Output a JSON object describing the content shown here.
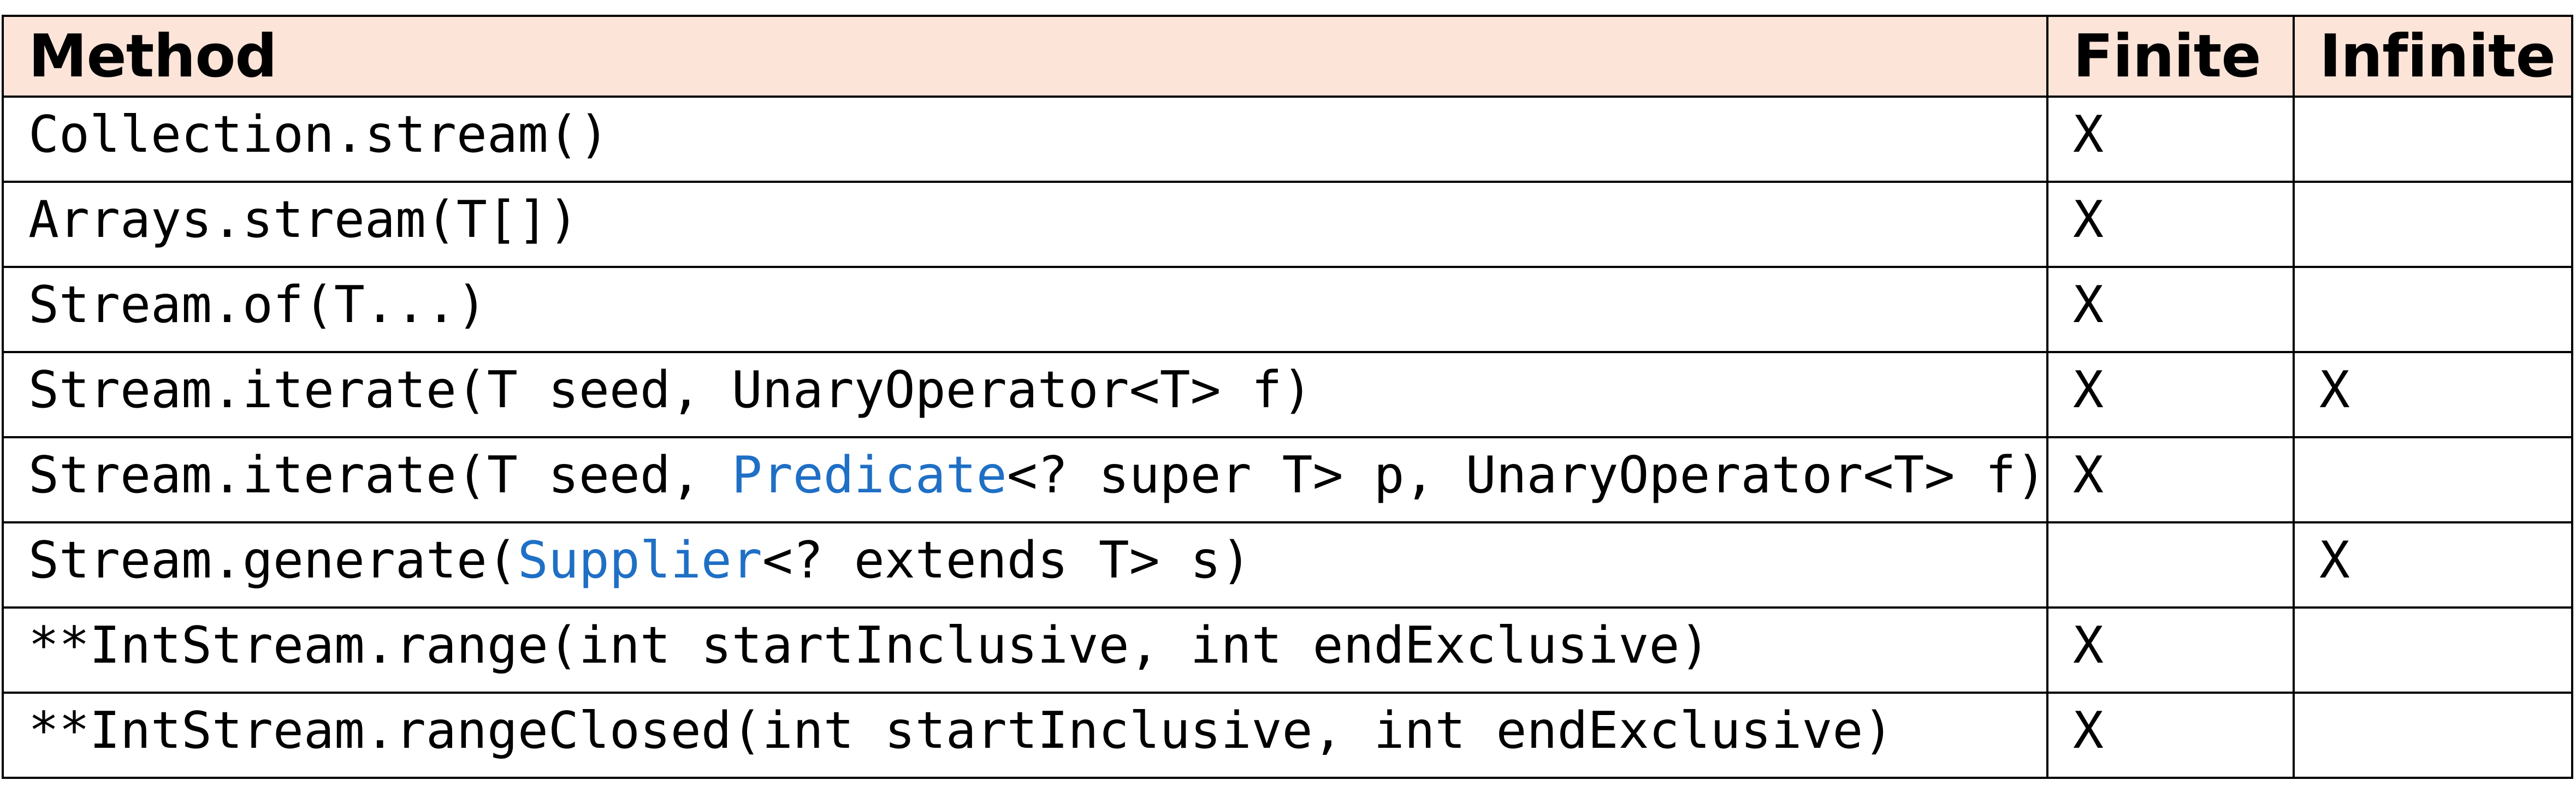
{
  "table": {
    "headers": {
      "method": "Method",
      "finite": "Finite",
      "infinite": "Infinite"
    },
    "accent_color": "#1f6fc5",
    "header_bg": "#fde4d8",
    "rows": [
      {
        "prefix": "Collection.stream()",
        "link": "",
        "suffix": "",
        "finite": "X",
        "infinite": ""
      },
      {
        "prefix": "Arrays.stream(T[])",
        "link": "",
        "suffix": "",
        "finite": "X",
        "infinite": ""
      },
      {
        "prefix": "Stream.of(T...)",
        "link": "",
        "suffix": "",
        "finite": "X",
        "infinite": ""
      },
      {
        "prefix": "Stream.iterate(T seed, UnaryOperator<T> f)",
        "link": "",
        "suffix": "",
        "finite": "X",
        "infinite": "X"
      },
      {
        "prefix": "Stream.iterate(T seed, ",
        "link": "Predicate",
        "suffix": "<? super T> p, UnaryOperator<T> f)",
        "finite": "X",
        "infinite": ""
      },
      {
        "prefix": "Stream.generate(",
        "link": "Supplier",
        "suffix": "<? extends T> s)",
        "finite": "",
        "infinite": "X"
      },
      {
        "prefix": "**IntStream.range(int startInclusive, int endExclusive)",
        "link": "",
        "suffix": "",
        "finite": "X",
        "infinite": ""
      },
      {
        "prefix": "**IntStream.rangeClosed(int startInclusive, int endExclusive)",
        "link": "",
        "suffix": "",
        "finite": "X",
        "infinite": ""
      }
    ]
  }
}
